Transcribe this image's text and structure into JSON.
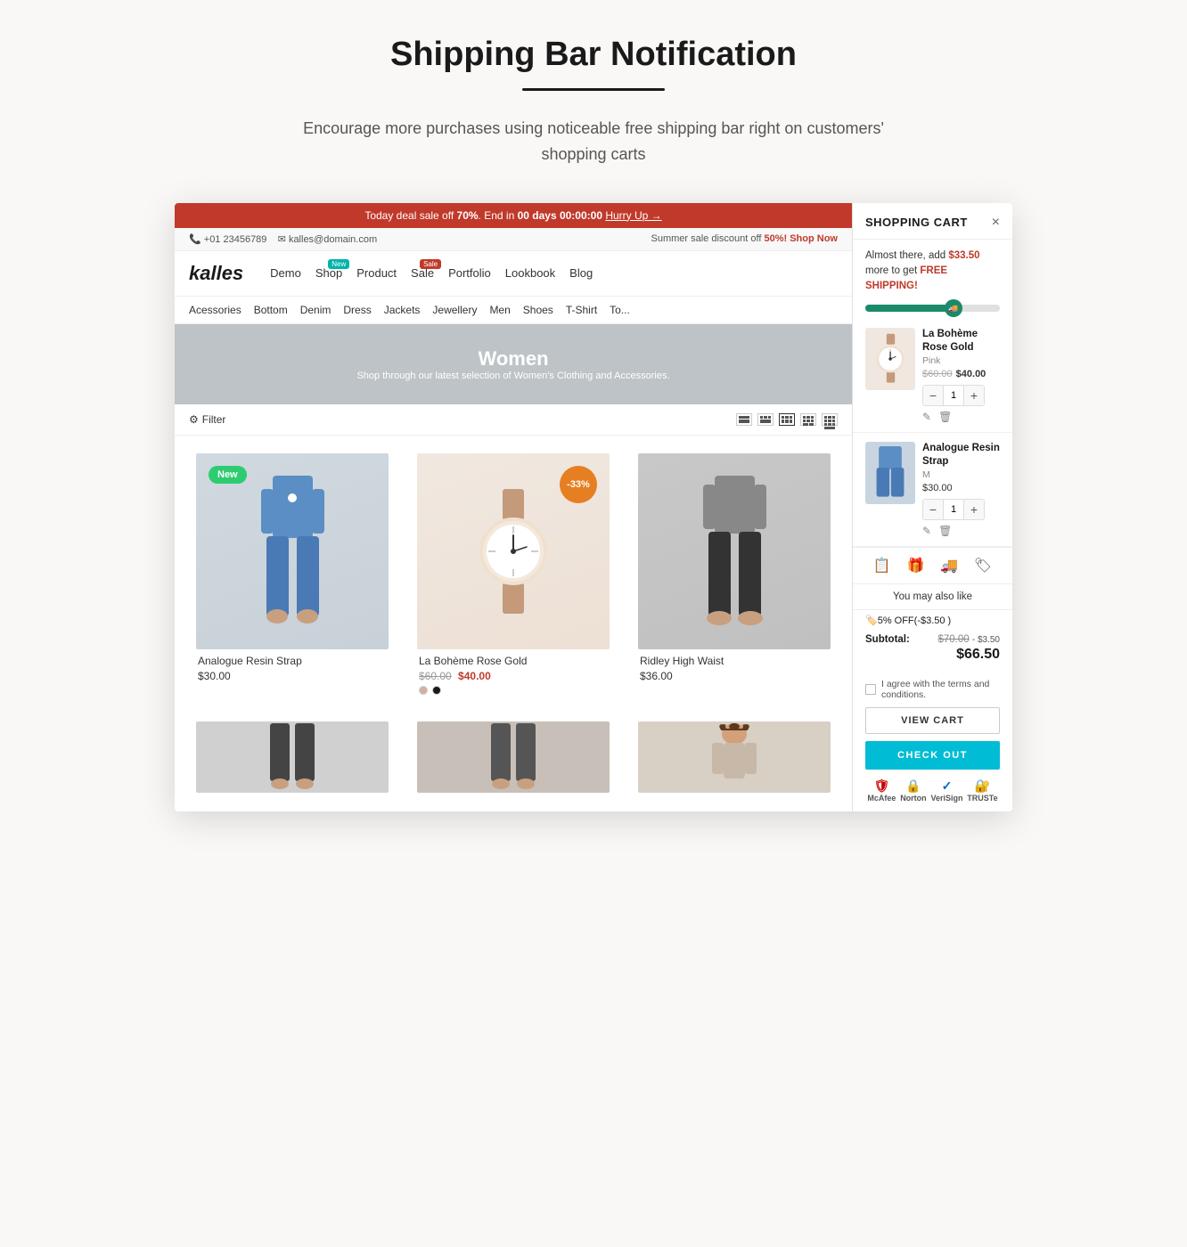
{
  "page": {
    "title": "Shipping Bar Notification",
    "divider": true,
    "subtitle": "Encourage more purchases using noticeable free shipping bar right on customers' shopping carts"
  },
  "store": {
    "deal_bar": {
      "text": "Today deal sale off",
      "percent": "70%",
      "end_text": "End in",
      "countdown": "00 days 00:00:00",
      "hurry": "Hurry Up →"
    },
    "top_bar": {
      "phone": "+01 23456789",
      "email": "kalles@domain.com",
      "sale_text": "Summer sale discount off",
      "sale_percent": "50%!",
      "shop_now": "Shop Now"
    },
    "nav": {
      "logo": "kalles",
      "items": [
        "Demo",
        "Shop",
        "Product",
        "Sale",
        "Portfolio",
        "Lookbook",
        "Blog"
      ],
      "badges": {
        "shop": "New",
        "sale": "Sale"
      }
    },
    "categories": [
      "Acessories",
      "Bottom",
      "Denim",
      "Dress",
      "Jackets",
      "Jewellery",
      "Men",
      "Shoes",
      "T-Shirt",
      "To..."
    ],
    "hero": {
      "title": "Women",
      "subtitle": "Shop through our latest selection of Women's Clothing and Accessories."
    },
    "filter": "Filter",
    "products": [
      {
        "name": "Analogue Resin Strap",
        "price_normal": "$30.00",
        "badge": "New",
        "badge_type": "new",
        "type": "pants-blue"
      },
      {
        "name": "La Bohème Rose Gold",
        "price_original": "$60.00",
        "price_sale": "$40.00",
        "badge": "-33%",
        "badge_type": "discount",
        "type": "watch-gold",
        "colors": [
          "#d4b0a0",
          "#1a1a1a"
        ]
      },
      {
        "name": "Ridley High Waist",
        "price_normal": "$36.00",
        "badge": null,
        "type": "pants-black"
      }
    ]
  },
  "cart": {
    "title": "SHOPPING CART",
    "close_icon": "×",
    "shipping_notice": {
      "text_prefix": "Almost there, add",
      "amount": "$33.50",
      "text_suffix": "more to get",
      "free_label": "FREE SHIPPING!"
    },
    "shipping_bar_fill": 70,
    "items": [
      {
        "name": "La Bohème Rose Gold",
        "variant": "Pink",
        "price_original": "$60.00",
        "price_sale": "$40.00",
        "qty": 1,
        "type": "watch"
      },
      {
        "name": "Analogue Resin Strap",
        "variant": "M",
        "price": "$30.00",
        "qty": 1,
        "type": "pants"
      }
    ],
    "you_may_like": "You may also like",
    "discount": {
      "label": "🏷️5% OFF(-$3.50 )",
      "amount": "-$3.50"
    },
    "subtotal": {
      "label": "Subtotal:",
      "original": "$70.00",
      "discount_display": "- $3.50",
      "final": "$66.50"
    },
    "terms_text": "I agree with the terms and conditions.",
    "view_cart": "VIEW CART",
    "checkout": "CHECK OUT",
    "trust_badges": [
      "McAfee SECURE",
      "Norton",
      "VeriSign",
      "TRUSTe"
    ]
  }
}
